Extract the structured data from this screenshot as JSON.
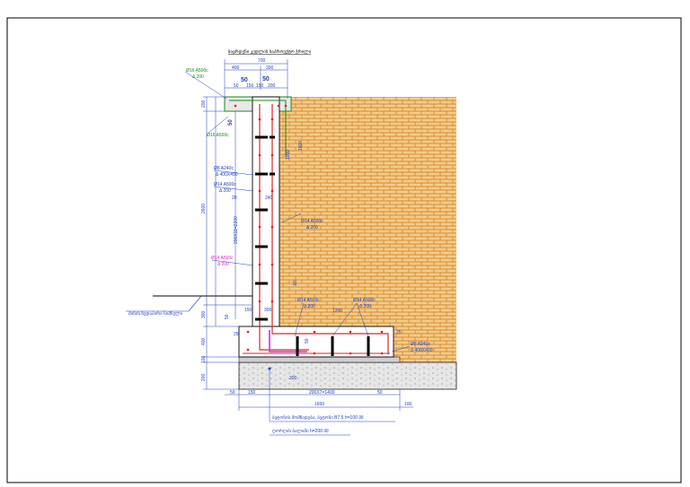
{
  "title": "საყრდენი კედლის საპროექტო ჭრილი",
  "colors": {
    "background": "#ffffff",
    "soil": "#d98a2a",
    "soil_bg": "#f2cc8c",
    "concrete": "#d9d9d9",
    "rebar_main": "#000000",
    "rebar_dot": "#e01b1b",
    "dim_blue": "#1f3fbf",
    "green": "#1a8a1a",
    "magenta": "#d62ad6",
    "frame": "#000000"
  },
  "top_dims": {
    "overall": "700",
    "left": "400",
    "right": "300",
    "a": "50",
    "b": "150",
    "c": "150",
    "d": "200",
    "top50a": "50",
    "top50b": "50"
  },
  "rebar_labels": {
    "r1_a": "Ø16 A500c",
    "r1_b": "Δ 200",
    "r2": "Ø16 A500c",
    "r3_a": "Ø8 A240c",
    "r3_b": "Δ 400X400",
    "r4_a": "Ø14 A500c",
    "r4_b": "Δ 200",
    "r5_a": "Ø14 A500c",
    "r5_b": "Δ 200",
    "r6_a": "Ø14 A500c",
    "r6_b": "Δ 200",
    "r7_a": "Ø14 A500c",
    "r7_b": "Δ 200",
    "r8_a": "Ø14 A500c",
    "r8_b": "Δ 200",
    "r9_a": "Ø8 A240c",
    "r9_b": "Δ 400X400"
  },
  "left_dims": {
    "d200_top": "200",
    "d2600": "2600",
    "d300": "300",
    "d400": "400",
    "d100": "100",
    "d200_bot": "200",
    "stem_spacing": "200X11=2200"
  },
  "inner_dims": {
    "d20": "20",
    "d240": "240",
    "d1000": "1000",
    "d1000b": "1000",
    "d50": "50",
    "d150": "150",
    "d300": "300",
    "d25": "25",
    "d25b": "25",
    "d1200": "1200",
    "d300b": "300",
    "d50b": "50",
    "d80": "80",
    "d50c": "50"
  },
  "bottom_dims": {
    "d50": "50",
    "d150": "150",
    "spacing": "200X7=1400",
    "d50b": "50",
    "overall": "1650",
    "d100": "100"
  },
  "ground_label": "მიწის ზედაპირი ნიშნული",
  "notes": {
    "n1": "ბეტონის მომზადება, ბეტონი B7.5 h=100 მმ",
    "n2": "ღორღის ბალიში h=200 მმ"
  }
}
